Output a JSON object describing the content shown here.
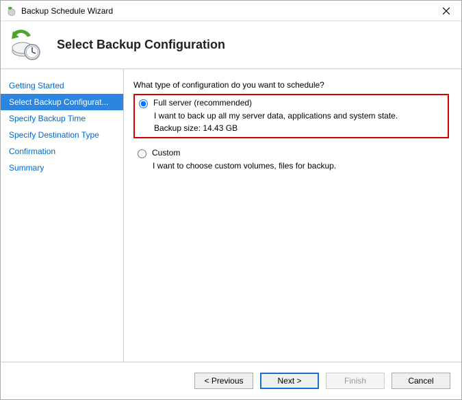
{
  "window": {
    "title": "Backup Schedule Wizard"
  },
  "header": {
    "heading": "Select Backup Configuration"
  },
  "sidebar": {
    "items": [
      {
        "label": "Getting Started"
      },
      {
        "label": "Select Backup Configurat..."
      },
      {
        "label": "Specify Backup Time"
      },
      {
        "label": "Specify Destination Type"
      },
      {
        "label": "Confirmation"
      },
      {
        "label": "Summary"
      }
    ],
    "selected_index": 1
  },
  "main": {
    "question": "What type of configuration do you want to schedule?",
    "options": [
      {
        "id": "full-server",
        "title": "Full server (recommended)",
        "desc": "I want to back up all my server data, applications and system state.",
        "size_label": "Backup size: 14.43 GB",
        "selected": true,
        "highlighted": true
      },
      {
        "id": "custom",
        "title": "Custom",
        "desc": "I want to choose custom volumes, files for backup.",
        "selected": false,
        "highlighted": false
      }
    ]
  },
  "footer": {
    "previous": "< Previous",
    "next": "Next >",
    "finish": "Finish",
    "cancel": "Cancel"
  }
}
